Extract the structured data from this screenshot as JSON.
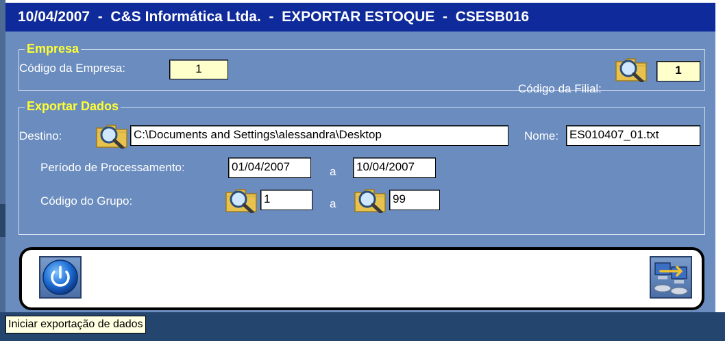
{
  "window": {
    "title": "10/04/2007  -  C&S Informática Ltda.  -  EXPORTAR ESTOQUE  -  CSESB016"
  },
  "empresa": {
    "group_title": "Empresa",
    "codigo_empresa_label": "Código da Empresa:",
    "codigo_empresa_value": "1",
    "codigo_filial_label": "Código da Filial:",
    "codigo_filial_value": "1"
  },
  "exportar": {
    "group_title": "Exportar Dados",
    "destino_label": "Destino:",
    "destino_value": "C:\\Documents and Settings\\alessandra\\Desktop",
    "nome_label": "Nome:",
    "nome_value": "ES010407_01.txt",
    "periodo_label": "Período de Processamento:",
    "periodo_inicio": "01/04/2007",
    "periodo_sep": "a",
    "periodo_fim": "10/04/2007",
    "grupo_label": "Código do Grupo:",
    "grupo_inicio": "1",
    "grupo_sep": "a",
    "grupo_fim": "99"
  },
  "tooltip": {
    "text": "Iniciar exportação de dados"
  },
  "colors": {
    "window_bg": "#6a8cbf",
    "titlebar_bg": "#0f2a9a",
    "group_title": "#ffff33",
    "field_yellow": "#ffffcc"
  },
  "icons": {
    "lookup": "folder-search-icon",
    "exit": "power-icon",
    "export": "export-transfer-icon"
  }
}
